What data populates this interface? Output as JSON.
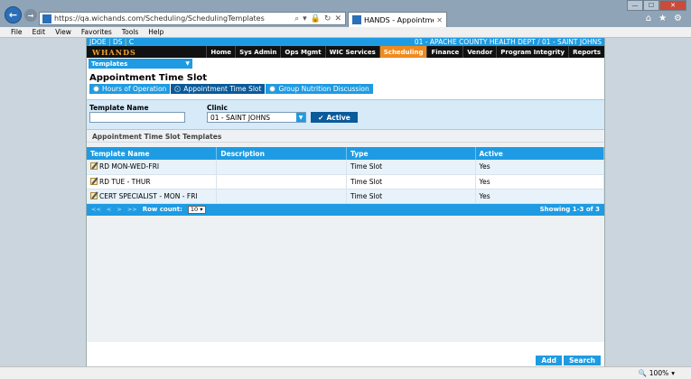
{
  "browser": {
    "url": "https://qa.wichands.com/Scheduling/SchedulingTemplates",
    "tab_title": "HANDS - Appointment Tim...",
    "menu": [
      "File",
      "Edit",
      "View",
      "Favorites",
      "Tools",
      "Help"
    ],
    "zoom": "100%"
  },
  "app": {
    "user": "JDOE",
    "user_role": "DS",
    "user_extra": "C",
    "clinic_context": "01 - APACHE COUNTY HEALTH DEPT / 01 - SAINT JOHNS",
    "logo_letters": [
      "W",
      "H",
      "A",
      "N",
      "D",
      "S"
    ],
    "nav": [
      {
        "label": "Home",
        "active": false
      },
      {
        "label": "Sys Admin",
        "active": false
      },
      {
        "label": "Ops Mgmt",
        "active": false
      },
      {
        "label": "WIC Services",
        "active": false
      },
      {
        "label": "Scheduling",
        "active": true
      },
      {
        "label": "Finance",
        "active": false
      },
      {
        "label": "Vendor",
        "active": false
      },
      {
        "label": "Program Integrity",
        "active": false
      },
      {
        "label": "Reports",
        "active": false
      }
    ],
    "templates_dropdown": "Templates",
    "accent": "#1e9be2",
    "active_nav_color": "#f08a1c"
  },
  "page": {
    "title": "Appointment Time Slot",
    "radio_tabs": [
      {
        "label": "Hours of Operation",
        "checked": false
      },
      {
        "label": "Appointment Time Slot",
        "checked": true
      },
      {
        "label": "Group Nutrition Discussion",
        "checked": false
      }
    ],
    "filters": {
      "template_name_label": "Template Name",
      "template_name_value": "",
      "clinic_label": "Clinic",
      "clinic_value": "01 - SAINT JOHNS",
      "active_button": "Active"
    },
    "section_title": "Appointment Time Slot Templates",
    "grid": {
      "columns": [
        "Template Name",
        "Description",
        "Type",
        "Active"
      ],
      "rows": [
        {
          "name": "RD MON-WED-FRI",
          "description": "",
          "type": "Time Slot",
          "active": "Yes"
        },
        {
          "name": "RD TUE - THUR",
          "description": "",
          "type": "Time Slot",
          "active": "Yes"
        },
        {
          "name": "CERT SPECIALIST - MON - FRI",
          "description": "",
          "type": "Time Slot",
          "active": "Yes"
        }
      ],
      "pager": {
        "first": "<<",
        "prev": "<",
        "next": ">",
        "last": ">>"
      },
      "row_count_label": "Row count:",
      "row_count_value": "10",
      "showing": "Showing 1-3 of 3"
    },
    "buttons": {
      "add": "Add",
      "search": "Search"
    }
  }
}
